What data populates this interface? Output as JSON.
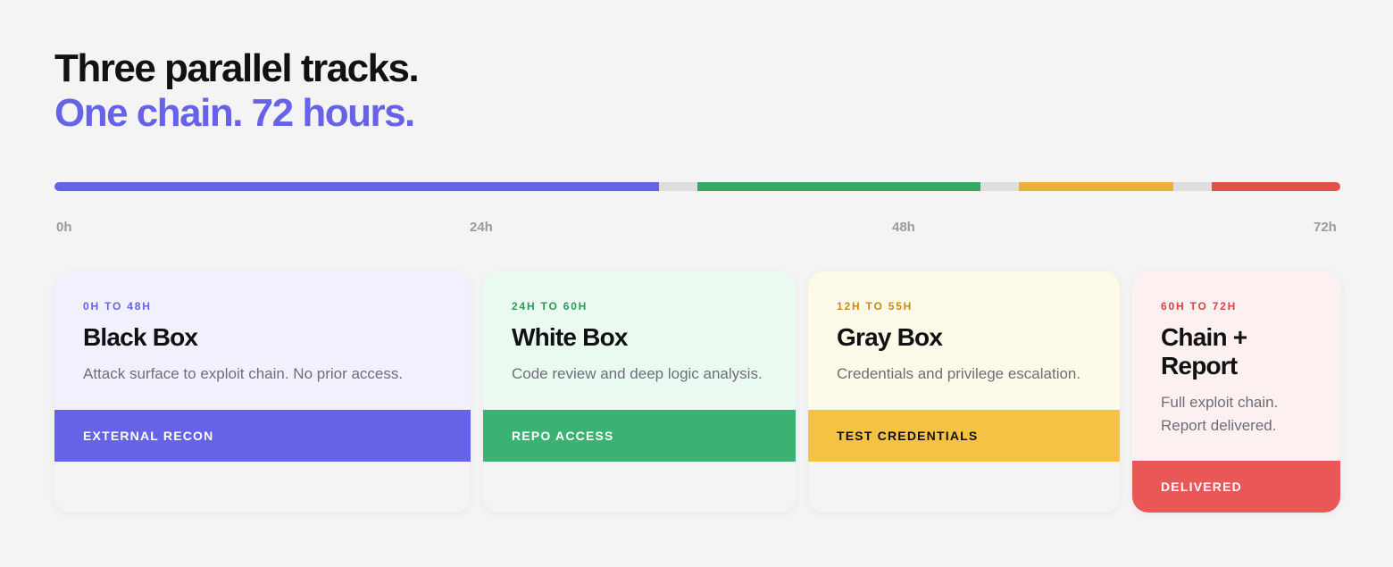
{
  "heading": {
    "line1": "Three parallel tracks.",
    "line2": "One chain. 72 hours."
  },
  "timeline": {
    "ticks": [
      "0h",
      "24h",
      "48h",
      "72h"
    ],
    "track_color": "#dedede",
    "segments": [
      {
        "name": "black-box",
        "color": "#6663e8"
      },
      {
        "name": "white-box",
        "color": "#34a865"
      },
      {
        "name": "gray-box",
        "color": "#ebb135"
      },
      {
        "name": "chain-report",
        "color": "#e34f4f"
      }
    ]
  },
  "cards": [
    {
      "range": "0H TO 48H",
      "title": "Black Box",
      "description": "Attack surface to exploit chain. No prior access.",
      "footer": "EXTERNAL RECON",
      "range_color": "#6663e8",
      "bg_color": "#f1f0fd",
      "footer_color": "#6663e8"
    },
    {
      "range": "24H TO 60H",
      "title": "White Box",
      "description": "Code review and deep logic analysis.",
      "footer": "REPO ACCESS",
      "range_color": "#2f9a5c",
      "bg_color": "#eafaf1",
      "footer_color": "#3bb273"
    },
    {
      "range": "12H TO 55H",
      "title": "Gray Box",
      "description": "Credentials and privilege escalation.",
      "footer": "TEST CREDENTIALS",
      "range_color": "#c98a1c",
      "bg_color": "#fefaea",
      "footer_color": "#f5c343"
    },
    {
      "range": "60H TO 72H",
      "title": "Chain + Report",
      "description": "Full exploit chain. Report delivered.",
      "footer": "DELIVERED",
      "range_color": "#d84444",
      "bg_color": "#fdf0f0",
      "footer_color": "#ea5757"
    }
  ]
}
